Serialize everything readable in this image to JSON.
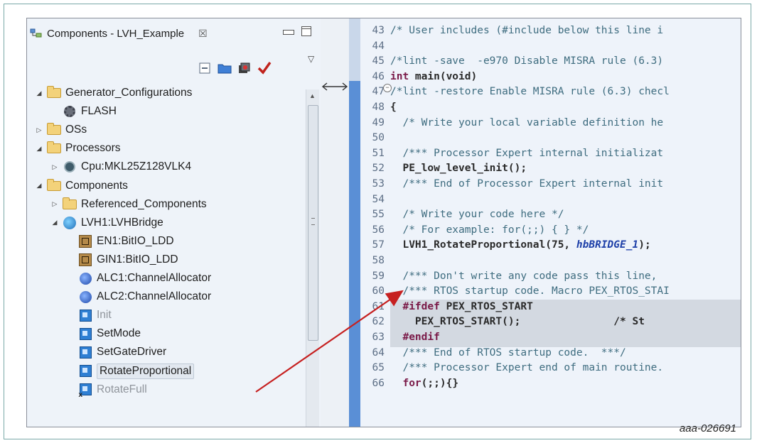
{
  "caption": "aaa-026691",
  "panel": {
    "tab_label": "Components - LVH_Example",
    "tab_close": "☒",
    "view_menu": "▽"
  },
  "tree": [
    {
      "label": "Generator_Configurations",
      "icon": "folder-icon",
      "arrow": "◢",
      "level": 0,
      "state": "normal"
    },
    {
      "label": "FLASH",
      "icon": "gear-icon",
      "arrow": "",
      "level": 1,
      "state": "normal"
    },
    {
      "label": "OSs",
      "icon": "folder-icon",
      "arrow": "▷",
      "level": 0,
      "state": "normal"
    },
    {
      "label": "Processors",
      "icon": "folder-icon",
      "arrow": "◢",
      "level": 0,
      "state": "normal"
    },
    {
      "label": "Cpu:MKL25Z128VLK4",
      "icon": "cpu-icon",
      "arrow": "▷",
      "level": 1,
      "state": "normal"
    },
    {
      "label": "Components",
      "icon": "folder-icon",
      "arrow": "◢",
      "level": 0,
      "state": "normal"
    },
    {
      "label": "Referenced_Components",
      "icon": "folder-icon",
      "arrow": "▷",
      "level": 1,
      "state": "normal"
    },
    {
      "label": "LVH1:LVHBridge",
      "icon": "component-icon",
      "arrow": "◢",
      "level": 1,
      "state": "normal"
    },
    {
      "label": "EN1:BitIO_LDD",
      "icon": "bitio-icon",
      "arrow": "",
      "level": 2,
      "state": "normal"
    },
    {
      "label": "GIN1:BitIO_LDD",
      "icon": "bitio-icon",
      "arrow": "",
      "level": 2,
      "state": "normal"
    },
    {
      "label": "ALC1:ChannelAllocator",
      "icon": "channel-icon",
      "arrow": "",
      "level": 2,
      "state": "normal"
    },
    {
      "label": "ALC2:ChannelAllocator",
      "icon": "channel-icon",
      "arrow": "",
      "level": 2,
      "state": "normal"
    },
    {
      "label": "Init",
      "icon": "method-icon",
      "arrow": "",
      "level": 2,
      "state": "dim"
    },
    {
      "label": "SetMode",
      "icon": "method-icon",
      "arrow": "",
      "level": 2,
      "state": "normal"
    },
    {
      "label": "SetGateDriver",
      "icon": "method-icon",
      "arrow": "",
      "level": 2,
      "state": "normal"
    },
    {
      "label": "RotateProportional",
      "icon": "method-icon",
      "arrow": "",
      "level": 2,
      "state": "selected"
    },
    {
      "label": "RotateFull",
      "icon": "method-disabled-icon",
      "arrow": "",
      "level": 2,
      "state": "dim"
    }
  ],
  "editor": {
    "lines": [
      {
        "n": "43",
        "t": "/* User includes (#include below this line i",
        "c": "cm"
      },
      {
        "n": "44",
        "t": "",
        "c": ""
      },
      {
        "n": "45",
        "t": "/*lint -save  -e970 Disable MISRA rule (6.3)",
        "c": "cm"
      },
      {
        "n": "46",
        "t": "int main(void)",
        "c": "kwline"
      },
      {
        "n": "47",
        "t": "/*lint -restore Enable MISRA rule (6.3) checl",
        "c": "cm"
      },
      {
        "n": "48",
        "t": "{",
        "c": "bold"
      },
      {
        "n": "49",
        "t": "  /* Write your local variable definition he",
        "c": "cm"
      },
      {
        "n": "50",
        "t": "",
        "c": ""
      },
      {
        "n": "51",
        "t": "  /*** Processor Expert internal initializat",
        "c": "cm"
      },
      {
        "n": "52",
        "t": "  PE_low_level_init();",
        "c": "bold"
      },
      {
        "n": "53",
        "t": "  /*** End of Processor Expert internal init",
        "c": "cm"
      },
      {
        "n": "54",
        "t": "",
        "c": ""
      },
      {
        "n": "55",
        "t": "  /* Write your code here */",
        "c": "cm"
      },
      {
        "n": "56",
        "t": "  /* For example: for(;;) { } */",
        "c": "cm"
      },
      {
        "n": "57",
        "t": "  LVH1_RotateProportional(75, ",
        "c": "callline",
        "extra": "hbBRIDGE_1",
        "tail": ");"
      },
      {
        "n": "58",
        "t": "",
        "c": ""
      },
      {
        "n": "59",
        "t": "  /*** Don't write any code pass this line, ",
        "c": "cm"
      },
      {
        "n": "60",
        "t": "  /*** RTOS startup code. Macro PEX_RTOS_STAI",
        "c": "cm"
      },
      {
        "n": "61",
        "t": "  #ifdef PEX_RTOS_START",
        "c": "pp"
      },
      {
        "n": "62",
        "t": "    PEX_RTOS_START();               /* St",
        "c": "bold"
      },
      {
        "n": "63",
        "t": "  #endif",
        "c": "pp"
      },
      {
        "n": "64",
        "t": "  /*** End of RTOS startup code.  ***/",
        "c": "cm"
      },
      {
        "n": "65",
        "t": "  /*** Processor Expert end of main routine.",
        "c": "cm"
      },
      {
        "n": "66",
        "t": "  for(;;){}",
        "c": "kwline"
      }
    ]
  }
}
